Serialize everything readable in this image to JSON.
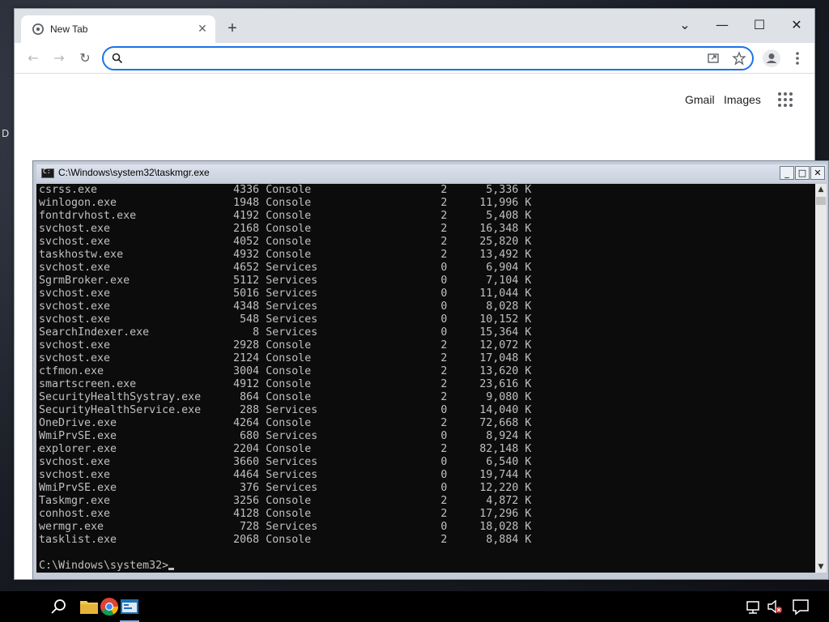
{
  "desktop": {
    "edge_text": "D"
  },
  "browser": {
    "tab": {
      "title": "New Tab",
      "close": "✕"
    },
    "new_tab": "+",
    "window_controls": {
      "tab_search": "⌄",
      "minimize": "—",
      "maximize": "☐",
      "close": "✕"
    },
    "toolbar": {
      "back": "←",
      "forward": "→",
      "reload": "↻"
    },
    "omnibox": {
      "value": "",
      "placeholder": ""
    },
    "ntp_links": {
      "gmail": "Gmail",
      "images": "Images"
    }
  },
  "console": {
    "title": "C:\\Windows\\system32\\taskmgr.exe",
    "buttons": {
      "minimize": "_",
      "maximize": "□",
      "close": "✕"
    },
    "processes": [
      {
        "name": "csrss.exe",
        "pid": "4336",
        "session": "Console",
        "num": "2",
        "mem": "5,336 K"
      },
      {
        "name": "winlogon.exe",
        "pid": "1948",
        "session": "Console",
        "num": "2",
        "mem": "11,996 K"
      },
      {
        "name": "fontdrvhost.exe",
        "pid": "4192",
        "session": "Console",
        "num": "2",
        "mem": "5,408 K"
      },
      {
        "name": "svchost.exe",
        "pid": "2168",
        "session": "Console",
        "num": "2",
        "mem": "16,348 K"
      },
      {
        "name": "svchost.exe",
        "pid": "4052",
        "session": "Console",
        "num": "2",
        "mem": "25,820 K"
      },
      {
        "name": "taskhostw.exe",
        "pid": "4932",
        "session": "Console",
        "num": "2",
        "mem": "13,492 K"
      },
      {
        "name": "svchost.exe",
        "pid": "4652",
        "session": "Services",
        "num": "0",
        "mem": "6,904 K"
      },
      {
        "name": "SgrmBroker.exe",
        "pid": "5112",
        "session": "Services",
        "num": "0",
        "mem": "7,104 K"
      },
      {
        "name": "svchost.exe",
        "pid": "5016",
        "session": "Services",
        "num": "0",
        "mem": "11,044 K"
      },
      {
        "name": "svchost.exe",
        "pid": "4348",
        "session": "Services",
        "num": "0",
        "mem": "8,028 K"
      },
      {
        "name": "svchost.exe",
        "pid": "548",
        "session": "Services",
        "num": "0",
        "mem": "10,152 K"
      },
      {
        "name": "SearchIndexer.exe",
        "pid": "8",
        "session": "Services",
        "num": "0",
        "mem": "15,364 K"
      },
      {
        "name": "svchost.exe",
        "pid": "2928",
        "session": "Console",
        "num": "2",
        "mem": "12,072 K"
      },
      {
        "name": "svchost.exe",
        "pid": "2124",
        "session": "Console",
        "num": "2",
        "mem": "17,048 K"
      },
      {
        "name": "ctfmon.exe",
        "pid": "3004",
        "session": "Console",
        "num": "2",
        "mem": "13,620 K"
      },
      {
        "name": "smartscreen.exe",
        "pid": "4912",
        "session": "Console",
        "num": "2",
        "mem": "23,616 K"
      },
      {
        "name": "SecurityHealthSystray.exe",
        "pid": "864",
        "session": "Console",
        "num": "2",
        "mem": "9,080 K"
      },
      {
        "name": "SecurityHealthService.exe",
        "pid": "288",
        "session": "Services",
        "num": "0",
        "mem": "14,040 K"
      },
      {
        "name": "OneDrive.exe",
        "pid": "4264",
        "session": "Console",
        "num": "2",
        "mem": "72,668 K"
      },
      {
        "name": "WmiPrvSE.exe",
        "pid": "680",
        "session": "Services",
        "num": "0",
        "mem": "8,924 K"
      },
      {
        "name": "explorer.exe",
        "pid": "2204",
        "session": "Console",
        "num": "2",
        "mem": "82,148 K"
      },
      {
        "name": "svchost.exe",
        "pid": "3660",
        "session": "Services",
        "num": "0",
        "mem": "6,540 K"
      },
      {
        "name": "svchost.exe",
        "pid": "4464",
        "session": "Services",
        "num": "0",
        "mem": "19,744 K"
      },
      {
        "name": "WmiPrvSE.exe",
        "pid": "376",
        "session": "Services",
        "num": "0",
        "mem": "12,220 K"
      },
      {
        "name": "Taskmgr.exe",
        "pid": "3256",
        "session": "Console",
        "num": "2",
        "mem": "4,872 K"
      },
      {
        "name": "conhost.exe",
        "pid": "4128",
        "session": "Console",
        "num": "2",
        "mem": "17,296 K"
      },
      {
        "name": "wermgr.exe",
        "pid": "728",
        "session": "Services",
        "num": "0",
        "mem": "18,028 K"
      },
      {
        "name": "tasklist.exe",
        "pid": "2068",
        "session": "Console",
        "num": "2",
        "mem": "8,884 K"
      }
    ],
    "prompt": "C:\\Windows\\system32>"
  },
  "taskbar": {
    "items": [
      "search-icon",
      "file-explorer-icon",
      "chrome-icon",
      "console-icon"
    ],
    "tray": [
      "network-icon",
      "volume-muted-icon",
      "notifications-icon"
    ]
  }
}
